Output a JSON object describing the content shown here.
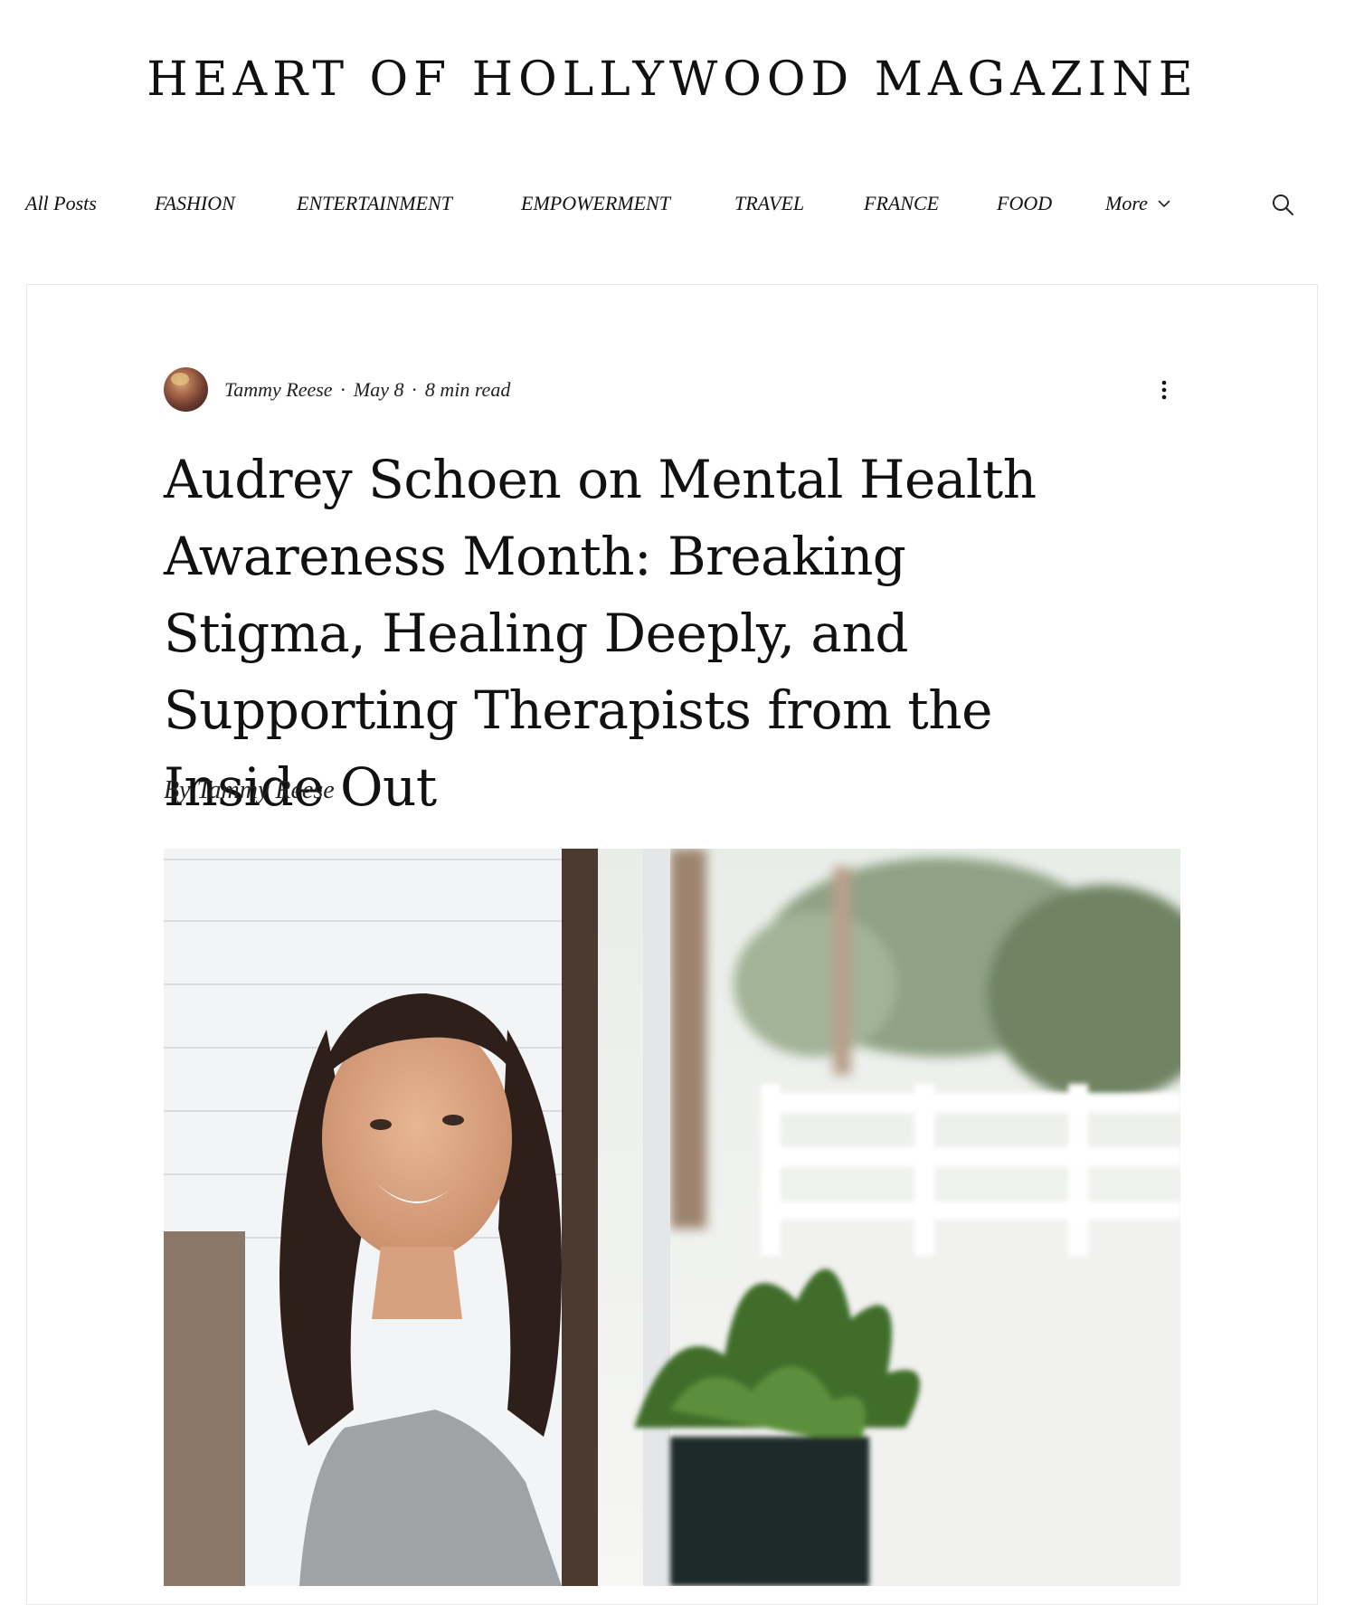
{
  "site": {
    "title": "HEART OF HOLLYWOOD MAGAZINE"
  },
  "nav": {
    "items": [
      {
        "label": "All Posts"
      },
      {
        "label": "FASHION"
      },
      {
        "label": "ENTERTAINMENT"
      },
      {
        "label": "EMPOWERMENT"
      },
      {
        "label": "TRAVEL"
      },
      {
        "label": "FRANCE"
      },
      {
        "label": "FOOD"
      },
      {
        "label": "More"
      }
    ],
    "more_icon": "chevron-down-icon",
    "search_icon": "search-icon"
  },
  "post": {
    "author": "Tammy Reese",
    "date": "May 8",
    "read_time": "8 min read",
    "separator": "·",
    "more_actions_icon": "more-vertical-icon",
    "title": "Audrey Schoen on Mental Health Awareness Month: Breaking Stigma, Healing Deeply, and Supporting Therapists from the Inside Out",
    "byline": "By Tammy Reese"
  },
  "colors": {
    "text": "#111111",
    "card_border": "#e6e6e6",
    "background": "#ffffff"
  }
}
